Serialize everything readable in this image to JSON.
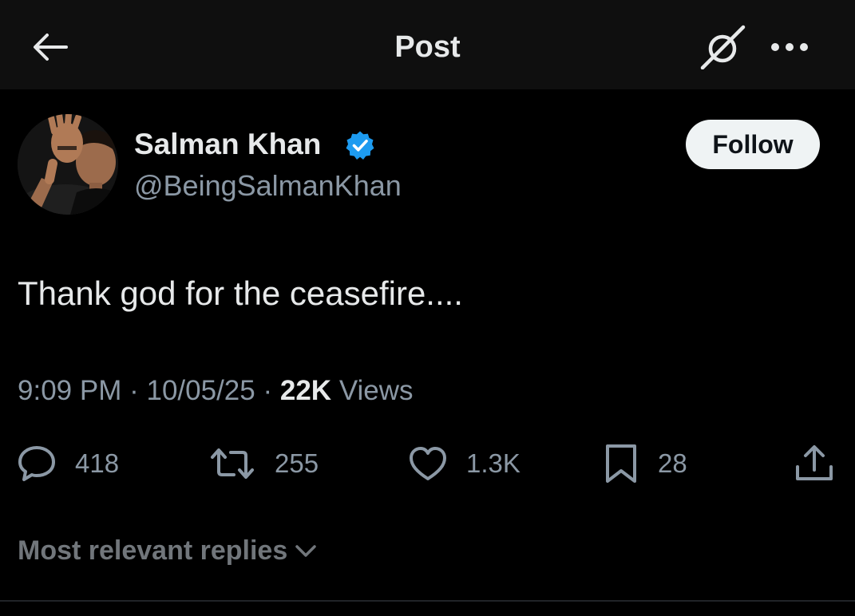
{
  "header": {
    "title": "Post",
    "back_icon": "arrow-left-icon",
    "grok_icon": "grok-icon",
    "more_icon": "more-horizontal-icon"
  },
  "author": {
    "display_name": "Salman Khan",
    "handle": "@BeingSalmanKhan",
    "verified": true,
    "verified_color": "#1d9bf0"
  },
  "follow_button": {
    "label": "Follow"
  },
  "post": {
    "text": "Thank god for the ceasefire....",
    "time": "9:09 PM",
    "date": "10/05/25",
    "separator": "·",
    "views_count": "22K",
    "views_label": "Views"
  },
  "actions": {
    "replies": "418",
    "reposts": "255",
    "likes": "1.3K",
    "bookmarks": "28"
  },
  "replies_sort": {
    "label": "Most relevant replies"
  },
  "colors": {
    "background": "#000000",
    "topbar": "#0f0f0f",
    "text_primary": "#e7e9ea",
    "text_secondary": "#8b98a5",
    "follow_bg": "#eff3f4"
  }
}
